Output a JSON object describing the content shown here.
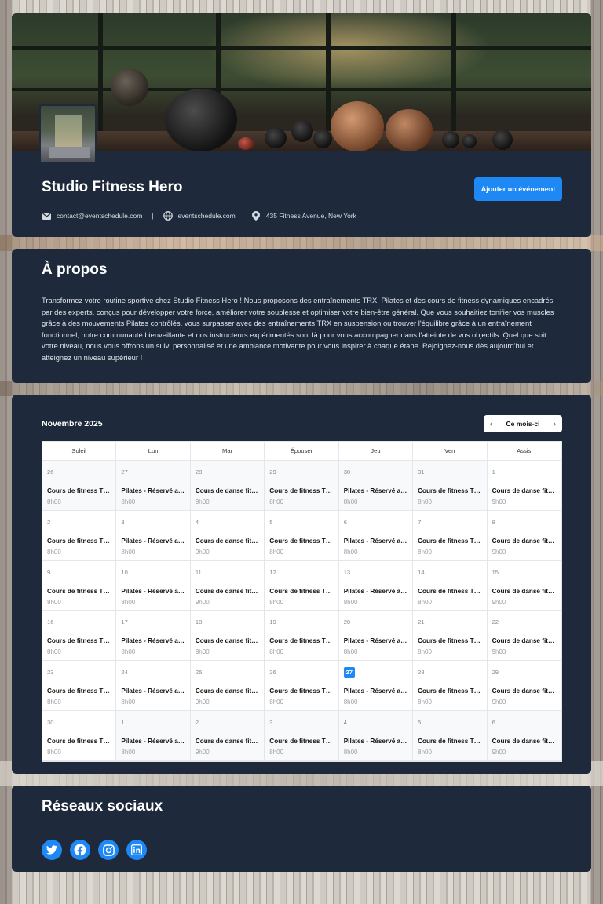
{
  "header": {
    "title": "Studio Fitness Hero",
    "add_event_label": "Ajouter un événement",
    "email": "contact@eventschedule.com",
    "separator": "|",
    "website": "eventschedule.com",
    "address": "435 Fitness Avenue, New York"
  },
  "about": {
    "title": "À propos",
    "text": "Transformez votre routine sportive chez Studio Fitness Hero ! Nous proposons des entraînements TRX, Pilates et des cours de fitness dynamiques encadrés par des experts, conçus pour développer votre force, améliorer votre souplesse et optimiser votre bien-être général. Que vous souhaitiez tonifier vos muscles grâce à des mouvements Pilates contrôlés, vous surpasser avec des entraînements TRX en suspension ou trouver l'équilibre grâce à un entraînement fonctionnel, notre communauté bienveillante et nos instructeurs expérimentés sont là pour vous accompagner dans l'atteinte de vos objectifs. Quel que soit votre niveau, nous vous offrons un suivi personnalisé et une ambiance motivante pour vous inspirer à chaque étape. Rejoignez-nous dès aujourd'hui et atteignez un niveau supérieur !"
  },
  "calendar": {
    "month_label": "Novembre 2025",
    "current_month_label": "Ce mois-ci",
    "prev_arrow": "‹",
    "next_arrow": "›",
    "weekdays": [
      "Soleil",
      "Lun",
      "Mar",
      "Épouser",
      "Jeu",
      "Ven",
      "Assis"
    ],
    "weeks": [
      [
        {
          "day": "26",
          "title": "Cours de fitness TRX",
          "time": "8h00",
          "other": true
        },
        {
          "day": "27",
          "title": "Pilates - Réservé aux membres",
          "time": "8h00",
          "other": true
        },
        {
          "day": "28",
          "title": "Cours de danse fitness",
          "time": "9h00",
          "other": true
        },
        {
          "day": "29",
          "title": "Cours de fitness TRX",
          "time": "8h00",
          "other": true
        },
        {
          "day": "30",
          "title": "Pilates - Réservé aux membres",
          "time": "8h00",
          "other": true
        },
        {
          "day": "31",
          "title": "Cours de fitness TRX",
          "time": "8h00",
          "other": true
        },
        {
          "day": "1",
          "title": "Cours de danse fitness",
          "time": "9h00",
          "other": false
        }
      ],
      [
        {
          "day": "2",
          "title": "Cours de fitness TRX",
          "time": "8h00",
          "other": false
        },
        {
          "day": "3",
          "title": "Pilates - Réservé aux membres",
          "time": "8h00",
          "other": false
        },
        {
          "day": "4",
          "title": "Cours de danse fitness",
          "time": "9h00",
          "other": false
        },
        {
          "day": "5",
          "title": "Cours de fitness TRX",
          "time": "8h00",
          "other": false
        },
        {
          "day": "6",
          "title": "Pilates - Réservé aux membres",
          "time": "8h00",
          "other": false
        },
        {
          "day": "7",
          "title": "Cours de fitness TRX",
          "time": "8h00",
          "other": false
        },
        {
          "day": "8",
          "title": "Cours de danse fitness",
          "time": "9h00",
          "other": false
        }
      ],
      [
        {
          "day": "9",
          "title": "Cours de fitness TRX",
          "time": "8h00",
          "other": false
        },
        {
          "day": "10",
          "title": "Pilates - Réservé aux membres",
          "time": "8h00",
          "other": false
        },
        {
          "day": "11",
          "title": "Cours de danse fitness",
          "time": "9h00",
          "other": false
        },
        {
          "day": "12",
          "title": "Cours de fitness TRX",
          "time": "8h00",
          "other": false
        },
        {
          "day": "13",
          "title": "Pilates - Réservé aux membres",
          "time": "8h00",
          "other": false
        },
        {
          "day": "14",
          "title": "Cours de fitness TRX",
          "time": "8h00",
          "other": false
        },
        {
          "day": "15",
          "title": "Cours de danse fitness",
          "time": "9h00",
          "other": false
        }
      ],
      [
        {
          "day": "16",
          "title": "Cours de fitness TRX",
          "time": "8h00",
          "other": false
        },
        {
          "day": "17",
          "title": "Pilates - Réservé aux membres",
          "time": "8h00",
          "other": false
        },
        {
          "day": "18",
          "title": "Cours de danse fitness",
          "time": "9h00",
          "other": false
        },
        {
          "day": "19",
          "title": "Cours de fitness TRX",
          "time": "8h00",
          "other": false
        },
        {
          "day": "20",
          "title": "Pilates - Réservé aux membres",
          "time": "8h00",
          "other": false
        },
        {
          "day": "21",
          "title": "Cours de fitness TRX",
          "time": "8h00",
          "other": false
        },
        {
          "day": "22",
          "title": "Cours de danse fitness",
          "time": "9h00",
          "other": false
        }
      ],
      [
        {
          "day": "23",
          "title": "Cours de fitness TRX",
          "time": "8h00",
          "other": false
        },
        {
          "day": "24",
          "title": "Pilates - Réservé aux membres",
          "time": "8h00",
          "other": false
        },
        {
          "day": "25",
          "title": "Cours de danse fitness",
          "time": "9h00",
          "other": false
        },
        {
          "day": "26",
          "title": "Cours de fitness TRX",
          "time": "8h00",
          "other": false
        },
        {
          "day": "27",
          "title": "Pilates - Réservé aux membres",
          "time": "8h00",
          "other": false,
          "today": true
        },
        {
          "day": "28",
          "title": "Cours de fitness TRX",
          "time": "8h00",
          "other": false
        },
        {
          "day": "29",
          "title": "Cours de danse fitness",
          "time": "9h00",
          "other": false
        }
      ],
      [
        {
          "day": "30",
          "title": "Cours de fitness TRX",
          "time": "8h00",
          "other": false
        },
        {
          "day": "1",
          "title": "Pilates - Réservé aux membres",
          "time": "8h00",
          "other": true
        },
        {
          "day": "2",
          "title": "Cours de danse fitness",
          "time": "9h00",
          "other": true
        },
        {
          "day": "3",
          "title": "Cours de fitness TRX",
          "time": "8h00",
          "other": true
        },
        {
          "day": "4",
          "title": "Pilates - Réservé aux membres",
          "time": "8h00",
          "other": true
        },
        {
          "day": "5",
          "title": "Cours de fitness TRX",
          "time": "8h00",
          "other": true
        },
        {
          "day": "6",
          "title": "Cours de danse fitness",
          "time": "9h00",
          "other": true
        }
      ]
    ]
  },
  "social": {
    "title": "Réseaux sociaux",
    "links": [
      {
        "name": "twitter",
        "icon": "twitter-icon"
      },
      {
        "name": "facebook",
        "icon": "facebook-icon"
      },
      {
        "name": "instagram",
        "icon": "instagram-icon"
      },
      {
        "name": "linkedin",
        "icon": "linkedin-icon"
      }
    ]
  },
  "colors": {
    "card_bg": "#1e293b",
    "accent": "#1e88f5",
    "today_badge": "#1e88f5"
  }
}
